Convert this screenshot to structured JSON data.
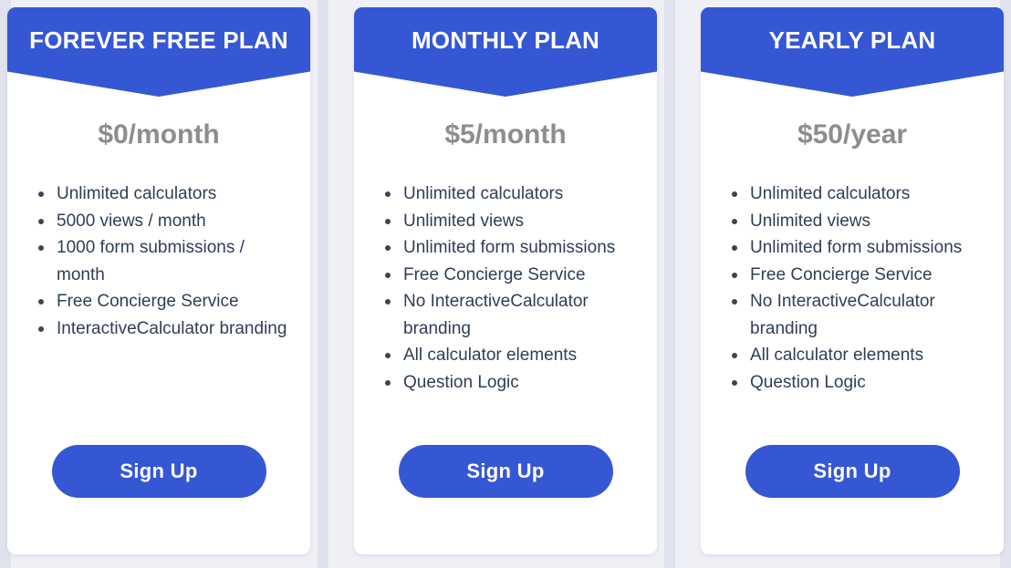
{
  "theme": {
    "page_background": "#eef0f5",
    "accent": "#3557d4",
    "price_color": "#8d8d8d",
    "feature_text_color": "#2f3e56",
    "card_background": "#ffffff"
  },
  "plans": [
    {
      "id": "forever-free",
      "title": "FOREVER FREE PLAN",
      "price": "$0/month",
      "features": [
        "Unlimited calculators",
        "5000 views / month",
        "1000 form submissions / month",
        "Free Concierge Service",
        "InteractiveCalculator branding"
      ],
      "cta_label": "Sign Up"
    },
    {
      "id": "monthly",
      "title": "MONTHLY PLAN",
      "price": "$5/month",
      "features": [
        "Unlimited calculators",
        "Unlimited views",
        "Unlimited form submissions",
        "Free Concierge Service",
        "No InteractiveCalculator branding",
        "All calculator elements",
        "Question Logic"
      ],
      "cta_label": "Sign Up"
    },
    {
      "id": "yearly",
      "title": "YEARLY PLAN",
      "price": "$50/year",
      "features": [
        "Unlimited calculators",
        "Unlimited views",
        "Unlimited form submissions",
        "Free Concierge Service",
        "No InteractiveCalculator branding",
        "All calculator elements",
        "Question Logic"
      ],
      "cta_label": "Sign Up"
    }
  ]
}
